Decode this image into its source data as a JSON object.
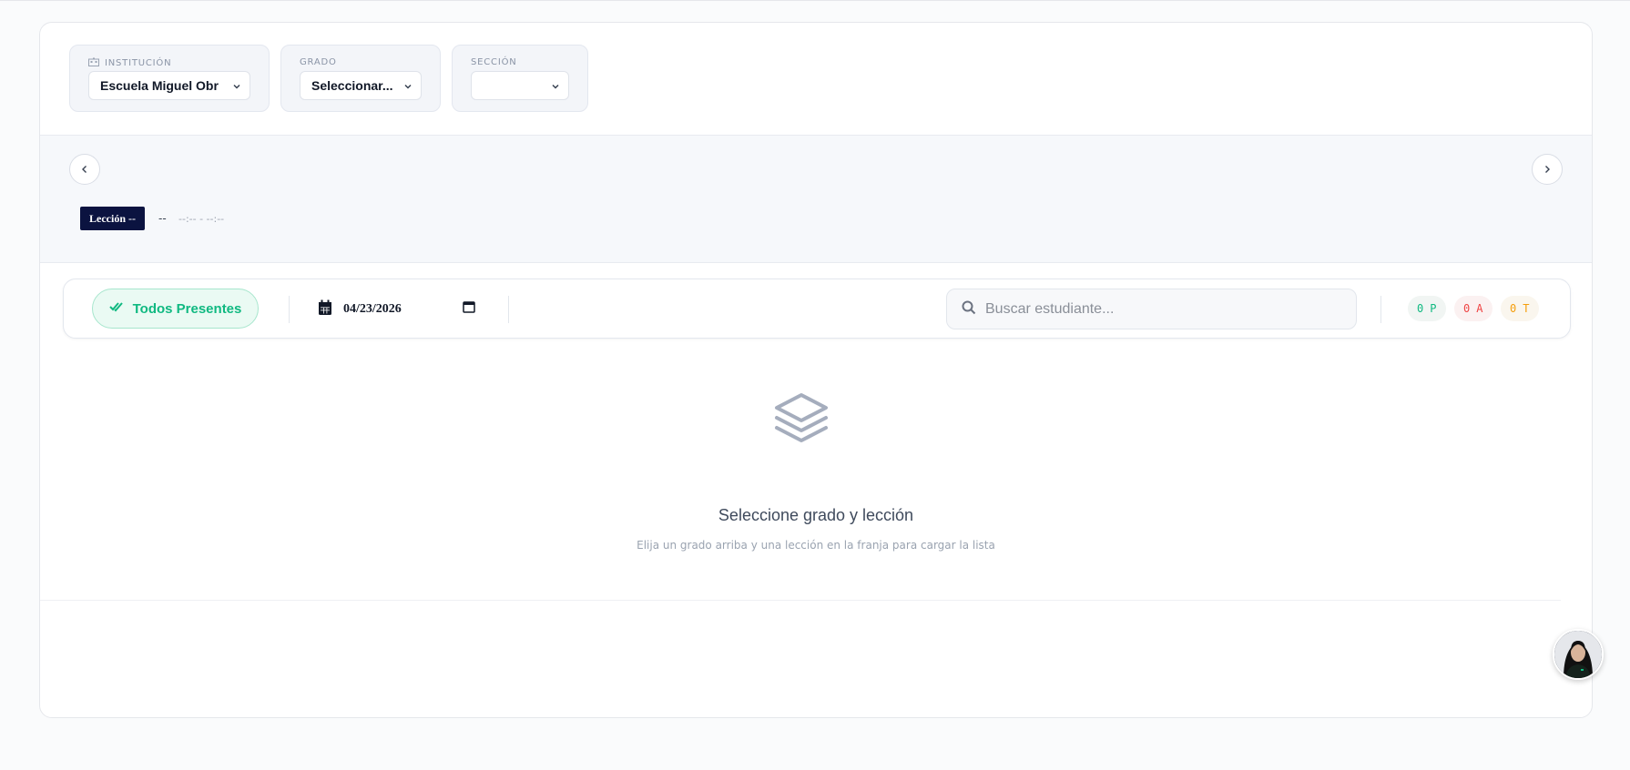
{
  "filters": {
    "institution": {
      "label": "INSTITUCIÓN",
      "value": "Escuela Miguel Obr"
    },
    "grade": {
      "label": "GRADO",
      "value": "Seleccionar..."
    },
    "section": {
      "label": "SECCIÓN",
      "value": ""
    }
  },
  "lesson": {
    "badge": "Lección --",
    "name": "--",
    "time": "--:-- - --:--"
  },
  "toolbar": {
    "all_present_label": "Todos Presentes",
    "date_value": "04/23/2026",
    "search_placeholder": "Buscar estudiante...",
    "counts": {
      "present": {
        "count": "0",
        "letter": "P"
      },
      "absent": {
        "count": "0",
        "letter": "A"
      },
      "late": {
        "count": "0",
        "letter": "T"
      }
    }
  },
  "empty_state": {
    "title": "Seleccione grado y lección",
    "subtitle": "Elija un grado arriba y una lección en la franja para cargar la lista"
  },
  "colors": {
    "accent_green": "#10b981",
    "absent_red": "#ef4444",
    "late_amber": "#f59e0b",
    "lesson_badge": "#0b1340"
  }
}
